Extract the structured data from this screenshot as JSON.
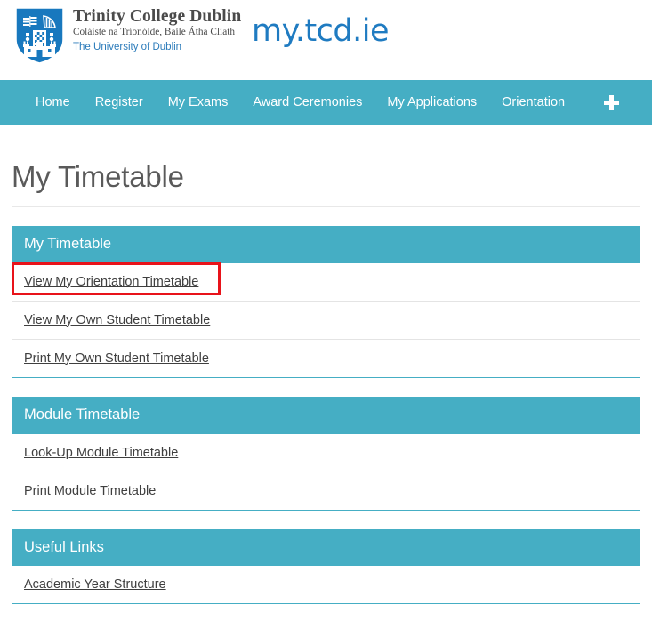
{
  "header": {
    "logo_icon": "trinity-shield-icon",
    "institution_name": "Trinity College Dublin",
    "institution_name_irish": "Coláiste na Tríonóide, Baile Átha Cliath",
    "institution_subtitle": "The University of Dublin",
    "wordmark": "my.tcd.ie"
  },
  "nav": {
    "items": [
      {
        "label": "Home"
      },
      {
        "label": "Register"
      },
      {
        "label": "My Exams"
      },
      {
        "label": "Award Ceremonies"
      },
      {
        "label": "My Applications"
      },
      {
        "label": "Orientation"
      }
    ],
    "add_icon": "plus-icon"
  },
  "page": {
    "title": "My Timetable"
  },
  "panels": [
    {
      "heading": "My Timetable",
      "links": [
        {
          "label": "View My Orientation Timetable",
          "highlighted": true
        },
        {
          "label": "View My Own Student Timetable",
          "highlighted": false
        },
        {
          "label": "Print My Own Student Timetable",
          "highlighted": false
        }
      ]
    },
    {
      "heading": "Module Timetable",
      "links": [
        {
          "label": "Look-Up Module Timetable",
          "highlighted": false
        },
        {
          "label": "Print Module Timetable",
          "highlighted": false
        }
      ]
    },
    {
      "heading": "Useful Links",
      "links": [
        {
          "label": "Academic Year Structure",
          "highlighted": false
        }
      ]
    }
  ],
  "colors": {
    "teal": "#45AEC4",
    "brand_blue": "#1f7bc1",
    "highlight_red": "#e8131a",
    "link_text": "#3f3f3f"
  }
}
